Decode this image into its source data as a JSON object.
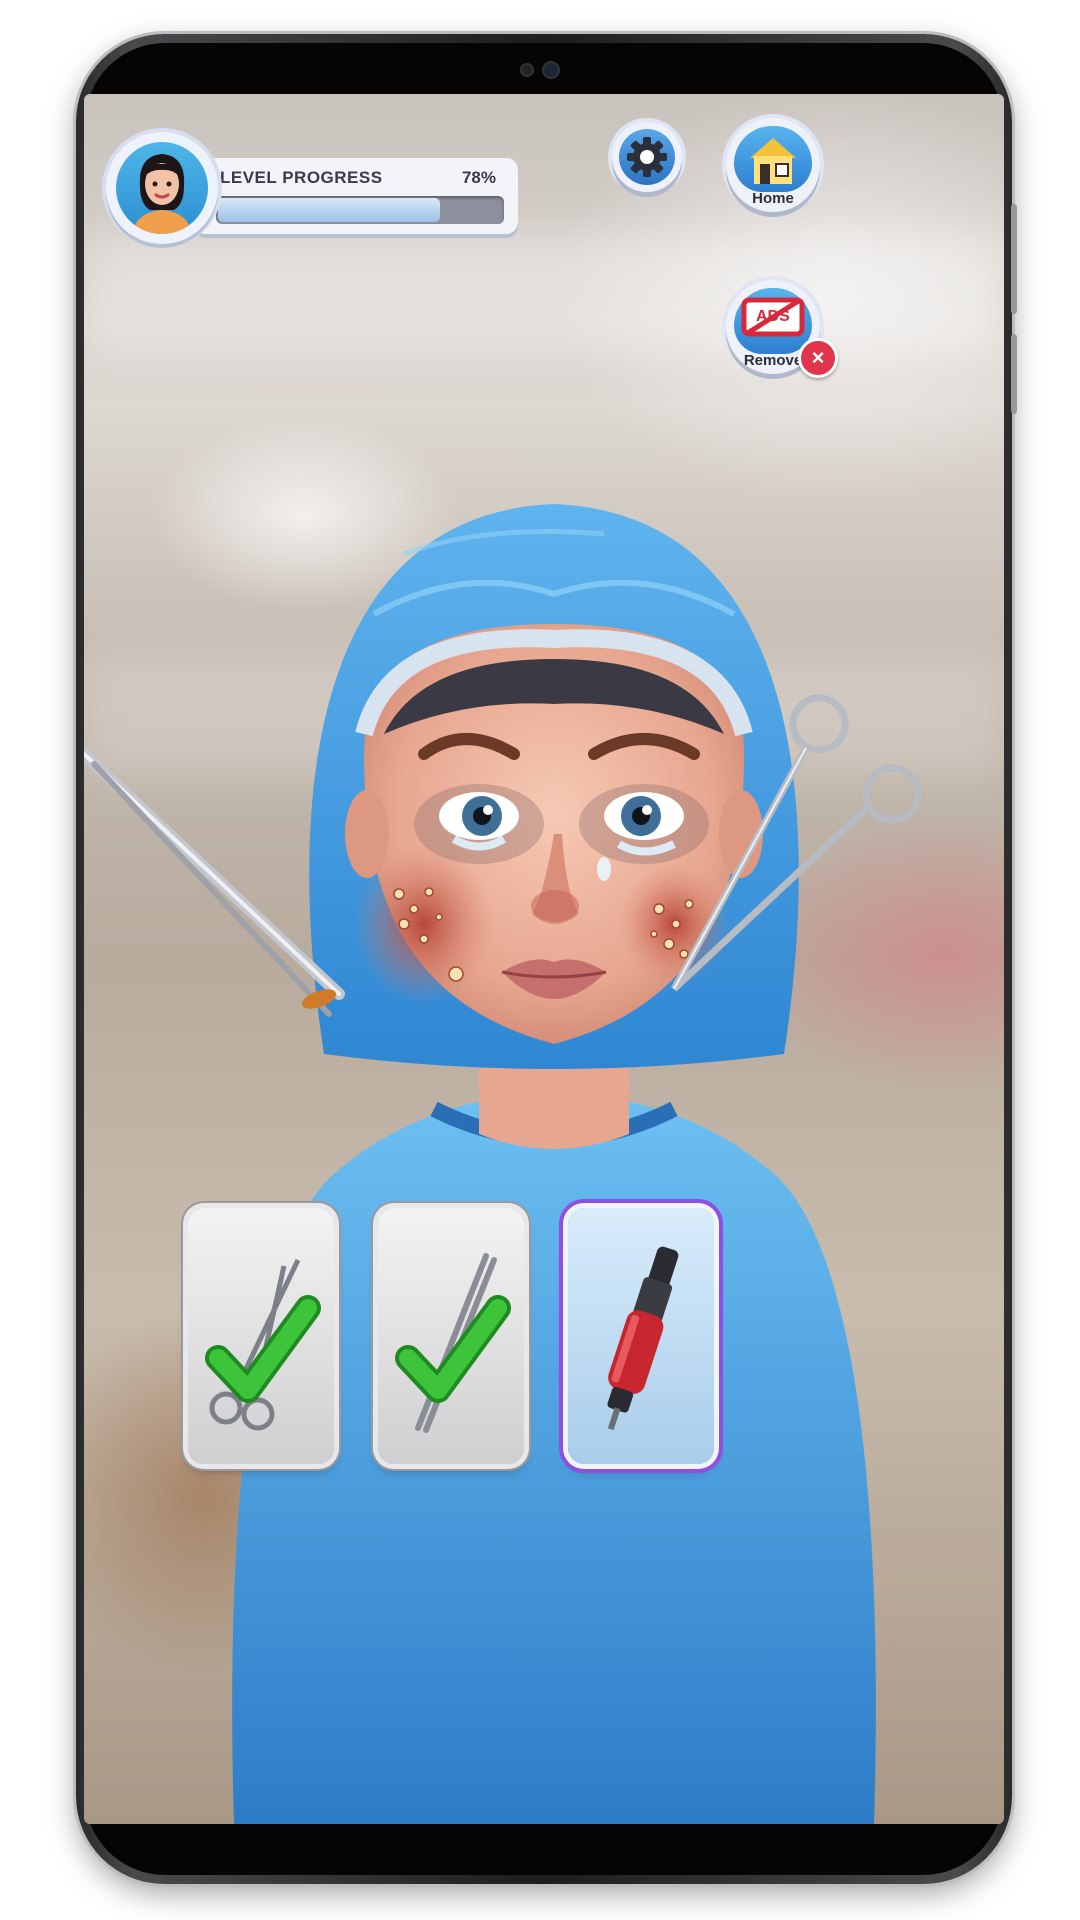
{
  "hud": {
    "progress_label": "LEVEL PROGRESS",
    "progress_value_text": "78%",
    "progress_fraction": 0.78
  },
  "buttons": {
    "home_label": "Home",
    "remove_ads_label": "Remove",
    "ads_badge_text": "ADS",
    "close_badge_text": "×"
  },
  "icons": {
    "avatar": "girl-avatar-icon",
    "settings": "gear-icon",
    "home": "house-icon",
    "remove_ads": "no-ads-icon",
    "close": "close-icon"
  },
  "tools": [
    {
      "name": "scissors-tool",
      "icon": "scissors-icon",
      "completed": true,
      "selected": false
    },
    {
      "name": "tweezers-tool",
      "icon": "tweezers-icon",
      "completed": true,
      "selected": false
    },
    {
      "name": "drill-tool",
      "icon": "drill-icon",
      "completed": false,
      "selected": true
    }
  ],
  "colors": {
    "check": "#3dc43a",
    "selected_border": "#8f4fe0",
    "progress_fill": "#9cc1e6",
    "close_badge": "#e0354b",
    "surgical_blue": "#3b9be0"
  }
}
